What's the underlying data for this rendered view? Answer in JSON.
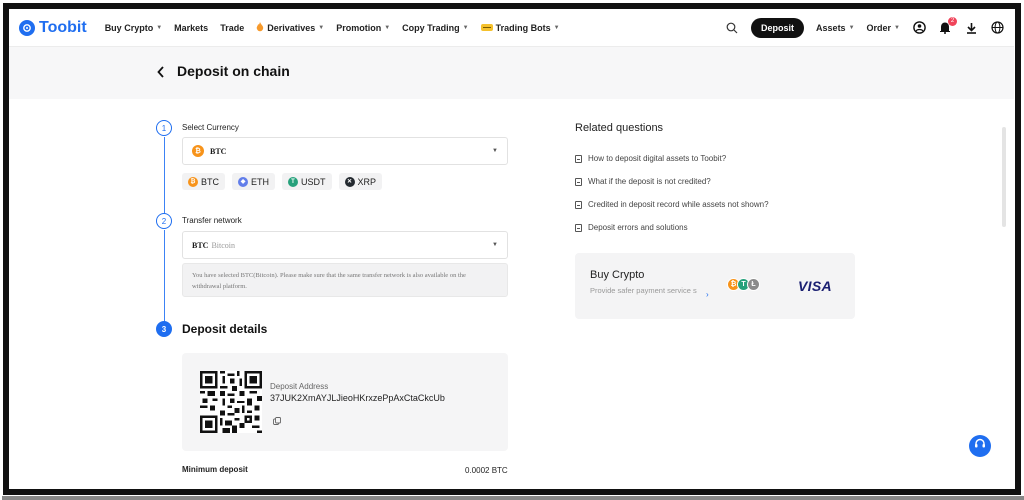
{
  "nav": {
    "brand": "Toobit",
    "items": [
      {
        "label": "Buy Crypto",
        "caret": true
      },
      {
        "label": "Markets",
        "caret": false
      },
      {
        "label": "Trade",
        "caret": false
      },
      {
        "label": "Derivatives",
        "caret": true
      },
      {
        "label": "Promotion",
        "caret": true
      },
      {
        "label": "Copy Trading",
        "caret": true
      },
      {
        "label": "Trading Bots",
        "caret": true
      }
    ],
    "deposit_label": "Deposit",
    "assets_label": "Assets",
    "order_label": "Order",
    "notification_count": "2"
  },
  "page": {
    "title": "Deposit on chain"
  },
  "steps": {
    "currency": {
      "number": "1",
      "label": "Select Currency",
      "selected": "BTC",
      "chips": [
        "BTC",
        "ETH",
        "USDT",
        "XRP"
      ]
    },
    "network": {
      "number": "2",
      "label": "Transfer network",
      "selected_code": "BTC",
      "selected_name": "Bitcoin",
      "note_line1": "You have selected BTC(Bitcoin). Please make sure that the same transfer network is also available on the",
      "note_line2": "withdrawal platform."
    },
    "details": {
      "number": "3",
      "label": "Deposit details",
      "address_label": "Deposit Address",
      "address": "37JUK2XmAYJLJieoHKrxzePpAxCtaCkcUb",
      "min_deposit_label": "Minimum deposit",
      "min_deposit_value": "0.0002 BTC"
    }
  },
  "related": {
    "title": "Related questions",
    "items": [
      "How to deposit digital assets to Toobit?",
      "What if the deposit is not credited?",
      "Credited in deposit record while assets not shown?",
      "Deposit errors and solutions"
    ]
  },
  "buy_card": {
    "title": "Buy Crypto",
    "subtitle": "Provide safer payment service s",
    "visa": "VISA"
  },
  "colors": {
    "brand": "#1f6ef0",
    "btc": "#f7931a",
    "eth": "#627eea",
    "usdt": "#26a17b",
    "xrp": "#23292f"
  },
  "icons": [
    "search-icon",
    "user-icon",
    "bell-icon",
    "download-icon",
    "globe-icon",
    "support-icon",
    "copy-icon",
    "document-icon"
  ]
}
